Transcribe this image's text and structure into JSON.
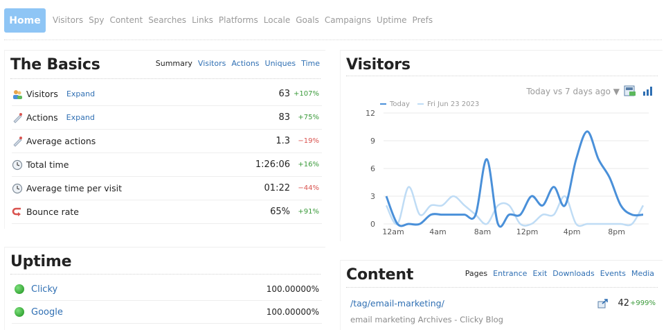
{
  "nav": {
    "home": "Home",
    "items": [
      "Visitors",
      "Spy",
      "Content",
      "Searches",
      "Links",
      "Platforms",
      "Locale",
      "Goals",
      "Campaigns",
      "Uptime",
      "Prefs"
    ]
  },
  "basics": {
    "title": "The Basics",
    "tabs": [
      "Summary",
      "Visitors",
      "Actions",
      "Uniques",
      "Time"
    ],
    "rows": [
      {
        "label": "Visitors",
        "expand": "Expand",
        "value": "63",
        "change": "+107%",
        "icon": "users-icon"
      },
      {
        "label": "Actions",
        "expand": "Expand",
        "value": "83",
        "change": "+75%",
        "icon": "cursor-icon"
      },
      {
        "label": "Average actions",
        "expand": "",
        "value": "1.3",
        "change": "−19%",
        "icon": "cursor-icon"
      },
      {
        "label": "Total time",
        "expand": "",
        "value": "1:26:06",
        "change": "+16%",
        "icon": "clock-icon"
      },
      {
        "label": "Average time per visit",
        "expand": "",
        "value": "01:22",
        "change": "−44%",
        "icon": "clock-icon"
      },
      {
        "label": "Bounce rate",
        "expand": "",
        "value": "65%",
        "change": "+91%",
        "icon": "bounce-icon"
      }
    ]
  },
  "visitors": {
    "title": "Visitors",
    "compare": "Today vs 7 days ago ▼"
  },
  "chart_data": {
    "type": "line",
    "x": [
      "12am",
      "1am",
      "2am",
      "3am",
      "4am",
      "5am",
      "6am",
      "7am",
      "8am",
      "9am",
      "10am",
      "11am",
      "12pm",
      "1pm",
      "2pm",
      "3pm",
      "4pm",
      "5pm",
      "6pm",
      "7pm",
      "8pm",
      "9pm",
      "10pm",
      "11pm"
    ],
    "xticks": [
      "12am",
      "4am",
      "8am",
      "12pm",
      "4pm",
      "8pm"
    ],
    "ylim": [
      0,
      12
    ],
    "yticks": [
      0,
      3,
      6,
      9,
      12
    ],
    "grid": true,
    "legend": "top-left",
    "series": [
      {
        "name": "Today",
        "color": "#4a90d9",
        "values": [
          3,
          0,
          0,
          0,
          1,
          1,
          1,
          1,
          1,
          7,
          0,
          1,
          1,
          3,
          2,
          4,
          2,
          7,
          10,
          7,
          5,
          2,
          1,
          1
        ]
      },
      {
        "name": "Fri Jun 23 2023",
        "color": "#bfdcf5",
        "values": [
          2,
          0,
          4,
          1,
          2,
          2,
          3,
          2,
          1,
          0,
          2,
          2,
          0,
          0,
          1,
          1,
          3,
          0,
          0,
          0,
          0,
          0,
          0,
          2
        ]
      }
    ]
  },
  "uptime": {
    "title": "Uptime",
    "rows": [
      {
        "name": "Clicky",
        "pct": "100.00000%"
      },
      {
        "name": "Google",
        "pct": "100.00000%"
      }
    ]
  },
  "content": {
    "title": "Content",
    "tabs": [
      "Pages",
      "Entrance",
      "Exit",
      "Downloads",
      "Events",
      "Media"
    ],
    "rows": [
      {
        "path": "/tag/email-marketing/",
        "subtitle": "email marketing Archives - Clicky Blog",
        "value": "42",
        "change": "+999%"
      }
    ]
  }
}
